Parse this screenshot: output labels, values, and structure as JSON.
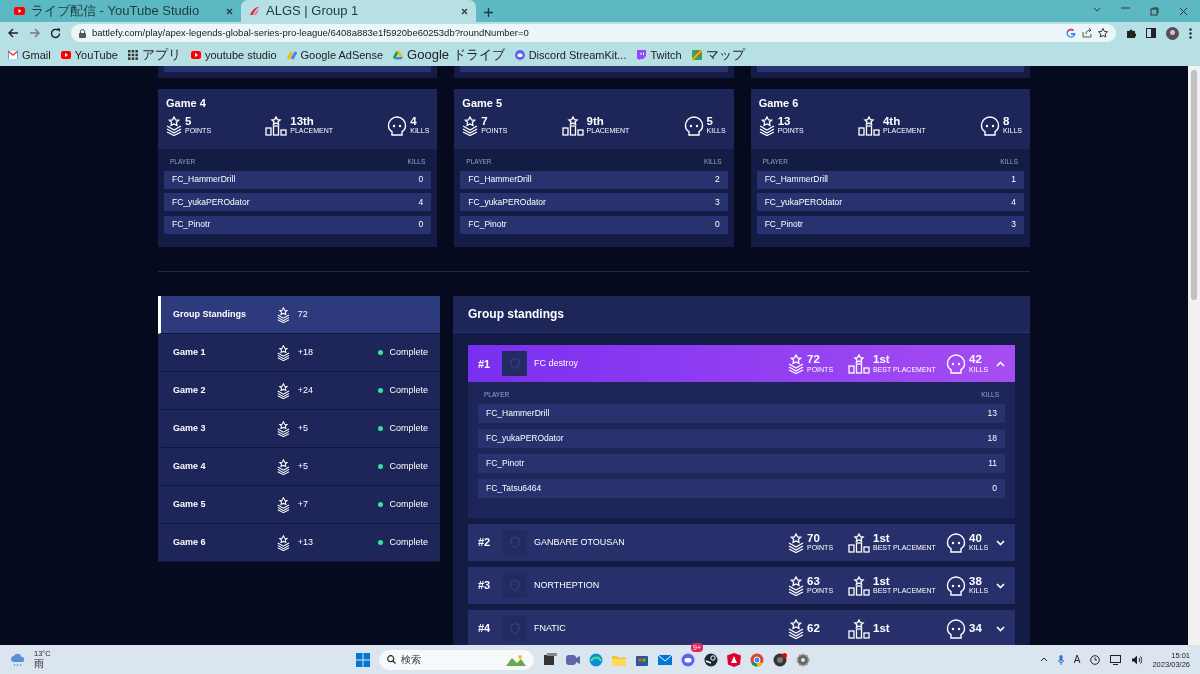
{
  "browser": {
    "tabs": [
      {
        "title": "ライブ配信 - YouTube Studio",
        "selected": false
      },
      {
        "title": "ALGS | Group 1",
        "selected": true
      }
    ],
    "url": "battlefy.com/play/apex-legends-global-series-pro-league/6408a883e1f5920be60253db?roundNumber=0",
    "bookmarks": [
      {
        "label": "Gmail"
      },
      {
        "label": "YouTube"
      },
      {
        "label": "アプリ"
      },
      {
        "label": "youtube studio"
      },
      {
        "label": "Google AdSense"
      },
      {
        "label": "Google ドライブ"
      },
      {
        "label": "Discord StreamKit..."
      },
      {
        "label": "Twitch"
      },
      {
        "label": "マップ"
      }
    ]
  },
  "games": [
    {
      "title": "Game 4",
      "points": "5",
      "points_label": "POINTS",
      "placement": "13th",
      "placement_label": "PLACEMENT",
      "kills": "4",
      "kills_label": "KILLS",
      "columns": [
        "PLAYER",
        "KILLS"
      ],
      "players": [
        {
          "name": "FC_HammerDrill",
          "kills": "0"
        },
        {
          "name": "FC_yukaPEROdator",
          "kills": "4"
        },
        {
          "name": "FC_Pinotr",
          "kills": "0"
        }
      ]
    },
    {
      "title": "Game 5",
      "points": "7",
      "points_label": "POINTS",
      "placement": "9th",
      "placement_label": "PLACEMENT",
      "kills": "5",
      "kills_label": "KILLS",
      "columns": [
        "PLAYER",
        "KILLS"
      ],
      "players": [
        {
          "name": "FC_HammerDrill",
          "kills": "2"
        },
        {
          "name": "FC_yukaPEROdator",
          "kills": "3"
        },
        {
          "name": "FC_Pinotr",
          "kills": "0"
        }
      ]
    },
    {
      "title": "Game 6",
      "points": "13",
      "points_label": "POINTS",
      "placement": "4th",
      "placement_label": "PLACEMENT",
      "kills": "8",
      "kills_label": "KILLS",
      "columns": [
        "PLAYER",
        "KILLS"
      ],
      "players": [
        {
          "name": "FC_HammerDrill",
          "kills": "1"
        },
        {
          "name": "FC_yukaPEROdator",
          "kills": "4"
        },
        {
          "name": "FC_Pinotr",
          "kills": "3"
        }
      ]
    }
  ],
  "standings_nav": [
    {
      "label": "Group Standings",
      "points": "72",
      "selected": true
    },
    {
      "label": "Game 1",
      "points": "+18",
      "status": "Complete",
      "color": "#2ee59d",
      "selected": false
    },
    {
      "label": "Game 2",
      "points": "+24",
      "status": "Complete",
      "color": "#2ee59d",
      "selected": false
    },
    {
      "label": "Game 3",
      "points": "+5",
      "status": "Complete",
      "color": "#2ee59d",
      "selected": false
    },
    {
      "label": "Game 4",
      "points": "+5",
      "status": "Complete",
      "color": "#2ee59d",
      "selected": false
    },
    {
      "label": "Game 5",
      "points": "+7",
      "status": "Complete",
      "color": "#2ee59d",
      "selected": false
    },
    {
      "label": "Game 6",
      "points": "+13",
      "status": "Complete",
      "color": "#2ee59d",
      "selected": false
    }
  ],
  "standings": {
    "title": "Group standings",
    "teams": [
      {
        "rank": "#1",
        "name": "FC destroy",
        "points": "72",
        "points_label": "POINTS",
        "best_placement": "1st",
        "best_placement_label": "BEST PLACEMENT",
        "kills": "42",
        "kills_label": "KILLS",
        "expanded": true,
        "columns": [
          "PLAYER",
          "KILLS"
        ],
        "players": [
          {
            "name": "FC_HammerDrill",
            "kills": "13"
          },
          {
            "name": "FC_yukaPEROdator",
            "kills": "18"
          },
          {
            "name": "FC_Pinotr",
            "kills": "11"
          },
          {
            "name": "FC_Tatsu6464",
            "kills": "0"
          }
        ]
      },
      {
        "rank": "#2",
        "name": "GANBARE OTOUSAN",
        "points": "70",
        "points_label": "POINTS",
        "best_placement": "1st",
        "best_placement_label": "BEST PLACEMENT",
        "kills": "40",
        "kills_label": "KILLS",
        "expanded": false
      },
      {
        "rank": "#3",
        "name": "NORTHEPTION",
        "points": "63",
        "points_label": "POINTS",
        "best_placement": "1st",
        "best_placement_label": "BEST PLACEMENT",
        "kills": "38",
        "kills_label": "KILLS",
        "expanded": false
      },
      {
        "rank": "#4",
        "name": "FNATIC",
        "points": "62",
        "best_placement": "1st",
        "kills": "34",
        "expanded": false
      }
    ]
  },
  "taskbar": {
    "temperature": "13°C",
    "weather": "雨",
    "search_placeholder": "検索",
    "discord_badge": "9+",
    "ime": "A",
    "time": "15:01",
    "date": "2023/03/26"
  }
}
